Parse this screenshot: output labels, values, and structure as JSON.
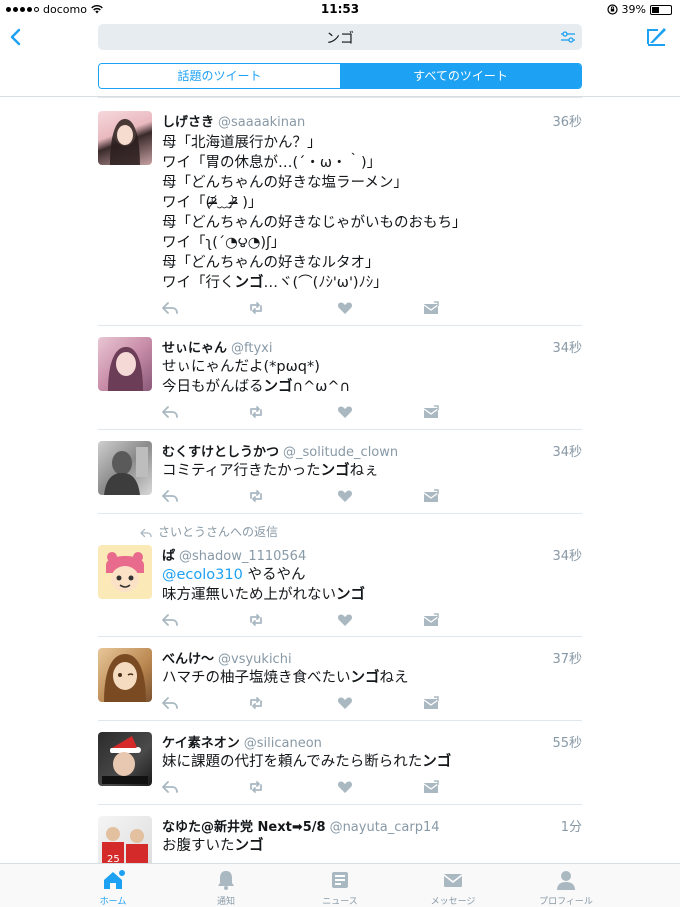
{
  "status": {
    "carrier": "docomo",
    "time": "11:53",
    "battery": "39%",
    "battery_level": 0.39
  },
  "search": {
    "query": "ンゴ"
  },
  "segments": [
    {
      "label": "話題のツイート",
      "active": false
    },
    {
      "label": "すべてのツイート",
      "active": true
    }
  ],
  "tweets": [
    {
      "name": "しげさき",
      "handle": "@saaaakinan",
      "time": "36秒",
      "lines": [
        [
          {
            "t": "母「北海道展行かん？」"
          }
        ],
        [
          {
            "t": "ワイ「胃の休息が…(´・ω・｀)」"
          }
        ],
        [
          {
            "t": "母「どんちゃんの好きな塩ラーメン」"
          }
        ],
        [
          {
            "t": "ワイ「(ᵒ̴̶̷᷄﹏ᵒ̴̶̷᷅ )」"
          }
        ],
        [
          {
            "t": "母「どんちゃんの好きなじゃがいものおもち」"
          }
        ],
        [
          {
            "t": "ワイ「ʅ(´◔౪◔)ʃ」"
          }
        ],
        [
          {
            "t": "母「どんちゃんの好きなルタオ」"
          }
        ],
        [
          {
            "t": "ワイ「行く"
          },
          {
            "t": "ンゴ",
            "hl": true
          },
          {
            "t": "…ヾ(⌒(ﾉｼ'ω')ﾉｼ」"
          }
        ]
      ]
    },
    {
      "name": "せぃにゃん",
      "handle": "@ftyxi",
      "time": "34秒",
      "lines": [
        [
          {
            "t": "せぃにゃんだよ(*pωq*)"
          }
        ],
        [
          {
            "t": "今日もがんばる"
          },
          {
            "t": "ンゴ",
            "hl": true
          },
          {
            "t": "∩^ω^∩"
          }
        ]
      ]
    },
    {
      "name": "むくすけとしうかつ",
      "handle": "@_solitude_clown",
      "time": "34秒",
      "lines": [
        [
          {
            "t": "コミティア行きたかった"
          },
          {
            "t": "ンゴ",
            "hl": true
          },
          {
            "t": "ねぇ"
          }
        ]
      ]
    },
    {
      "reply_context": "さいとうさんへの返信",
      "name": "ぱ",
      "handle": "@shadow_1110564",
      "time": "34秒",
      "lines": [
        [
          {
            "t": "@ecolo310",
            "mention": true
          },
          {
            "t": " やるやん"
          }
        ],
        [
          {
            "t": "味方運無いため上がれない"
          },
          {
            "t": "ンゴ",
            "hl": true
          }
        ]
      ]
    },
    {
      "name": "べんけ〜",
      "handle": "@vsyukichi",
      "time": "37秒",
      "lines": [
        [
          {
            "t": "ハマチの柚子塩焼き食べたい"
          },
          {
            "t": "ンゴ",
            "hl": true
          },
          {
            "t": "ねえ"
          }
        ]
      ]
    },
    {
      "name": "ケイ素ネオン",
      "handle": "@silicaneon",
      "time": "55秒",
      "lines": [
        [
          {
            "t": "妹に課題の代打を頼んでみたら断られた"
          },
          {
            "t": "ンゴ",
            "hl": true
          }
        ]
      ]
    },
    {
      "name": "なゆた@新井党 Next➡5/8",
      "handle": "@nayuta_carp14",
      "time": "1分",
      "lines": [
        [
          {
            "t": "お腹すいた"
          },
          {
            "t": "ンゴ",
            "hl": true
          }
        ]
      ]
    }
  ],
  "tabs": [
    {
      "label": "ホーム",
      "icon": "home-icon",
      "active": true
    },
    {
      "label": "通知",
      "icon": "bell-icon",
      "active": false
    },
    {
      "label": "ニュース",
      "icon": "news-icon",
      "active": false
    },
    {
      "label": "メッセージ",
      "icon": "envelope-icon",
      "active": false
    },
    {
      "label": "プロフィール",
      "icon": "person-icon",
      "active": false
    }
  ],
  "colors": {
    "accent": "#1da1f2",
    "secondary_text": "#8899a6",
    "icon_gray": "#aab8c2",
    "search_bg": "#e6ecf0"
  }
}
